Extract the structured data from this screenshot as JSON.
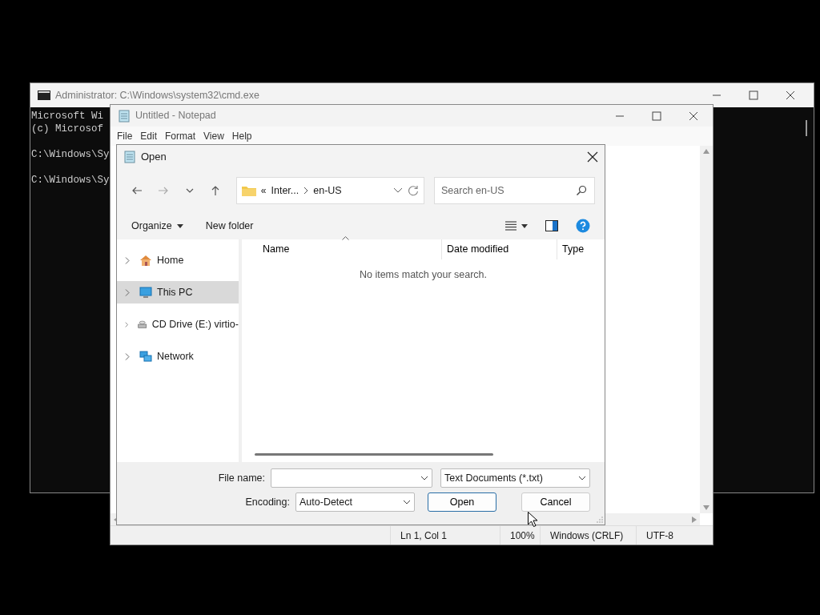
{
  "cmd_window": {
    "title": "Administrator: C:\\Windows\\system32\\cmd.exe",
    "blocks": [
      [
        "Microsoft Wi",
        "(c) Microsof"
      ],
      [
        "C:\\Windows\\Sy"
      ],
      [
        "C:\\Windows\\Sy"
      ]
    ]
  },
  "notepad": {
    "title": "Untitled - Notepad",
    "menu": [
      "File",
      "Edit",
      "Format",
      "View",
      "Help"
    ],
    "status_bar": [
      "Ln 1, Col 1",
      "100%",
      "Windows (CRLF)",
      "UTF-8"
    ]
  },
  "open_dialog": {
    "title": "Open",
    "address": {
      "overflow": "«",
      "segments": [
        "Inter...",
        "en-US"
      ]
    },
    "search": {
      "placeholder": "Search en-US"
    },
    "toolbar": {
      "organize": "Organize",
      "new_folder": "New folder"
    },
    "sidebar": {
      "items": [
        {
          "label": "Home",
          "kind": "home",
          "selected": false
        },
        {
          "label": "This PC",
          "kind": "pc",
          "selected": true
        },
        {
          "label": "CD Drive (E:) virtio-",
          "kind": "drive",
          "selected": false
        },
        {
          "label": "Network",
          "kind": "network",
          "selected": false
        }
      ]
    },
    "columns": [
      {
        "label": "Name",
        "sorted": true
      },
      {
        "label": "Date modified",
        "sorted": false
      },
      {
        "label": "Type",
        "sorted": false
      }
    ],
    "empty_message": "No items match your search.",
    "file_name": {
      "label": "File name:"
    },
    "file_type": "Text Documents (*.txt)",
    "encoding": {
      "label": "Encoding:",
      "value": "Auto-Detect"
    },
    "buttons": [
      {
        "label": "Open",
        "default": true
      },
      {
        "label": "Cancel",
        "default": false
      }
    ]
  }
}
